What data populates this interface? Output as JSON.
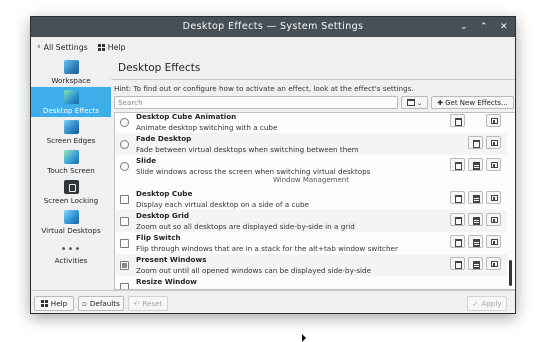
{
  "window": {
    "title": "Desktop Effects — System Settings",
    "controls": [
      "⌄",
      "⌃",
      "✕"
    ]
  },
  "toolbar": {
    "all_settings": "All Settings",
    "help": "Help"
  },
  "sidebar": {
    "items": [
      {
        "label": "Workspace",
        "icon": "workspace-icon"
      },
      {
        "label": "Desktop Effects",
        "icon": "desktop-effects-icon",
        "active": true
      },
      {
        "label": "Screen Edges",
        "icon": "screen-edges-icon"
      },
      {
        "label": "Touch Screen",
        "icon": "touch-screen-icon"
      },
      {
        "label": "Screen Locking",
        "icon": "screen-locking-icon"
      },
      {
        "label": "Virtual Desktops",
        "icon": "virtual-desktops-icon"
      },
      {
        "label": "Activities",
        "icon": "activities-icon"
      }
    ]
  },
  "main": {
    "title": "Desktop Effects",
    "hint": "Hint: To find out or configure how to activate an effect, look at the effect's settings.",
    "search_placeholder": "Search",
    "get_new_label": "Get New Effects...",
    "group_heading": "Window Management",
    "effects": [
      {
        "title": "Desktop Cube Animation",
        "desc": "Animate desktop switching with a cube",
        "control": "radio",
        "checked": false
      },
      {
        "title": "Fade Desktop",
        "desc": "Fade between virtual desktops when switching between them",
        "control": "radio",
        "checked": false
      },
      {
        "title": "Slide",
        "desc": "Slide windows across the screen when switching virtual desktops",
        "control": "radio",
        "checked": false
      },
      {
        "title": "Desktop Cube",
        "desc": "Display each virtual desktop on a side of a cube",
        "control": "checkbox",
        "checked": false
      },
      {
        "title": "Desktop Grid",
        "desc": "Zoom out so all desktops are displayed side-by-side in a grid",
        "control": "checkbox",
        "checked": false
      },
      {
        "title": "Flip Switch",
        "desc": "Flip through windows that are in a stack for the alt+tab window switcher",
        "control": "checkbox",
        "checked": false
      },
      {
        "title": "Present Windows",
        "desc": "Zoom out until all opened windows can be displayed side-by-side",
        "control": "checkbox",
        "checked": "partial"
      },
      {
        "title": "Resize Window",
        "desc": "",
        "control": "checkbox",
        "checked": false
      }
    ]
  },
  "footer": {
    "help": "Help",
    "defaults": "Defaults",
    "reset": "Reset",
    "apply": "Apply"
  },
  "colors": {
    "titlebar": "#475057",
    "selection": "#3daee9",
    "window_bg": "#eff0f1"
  }
}
